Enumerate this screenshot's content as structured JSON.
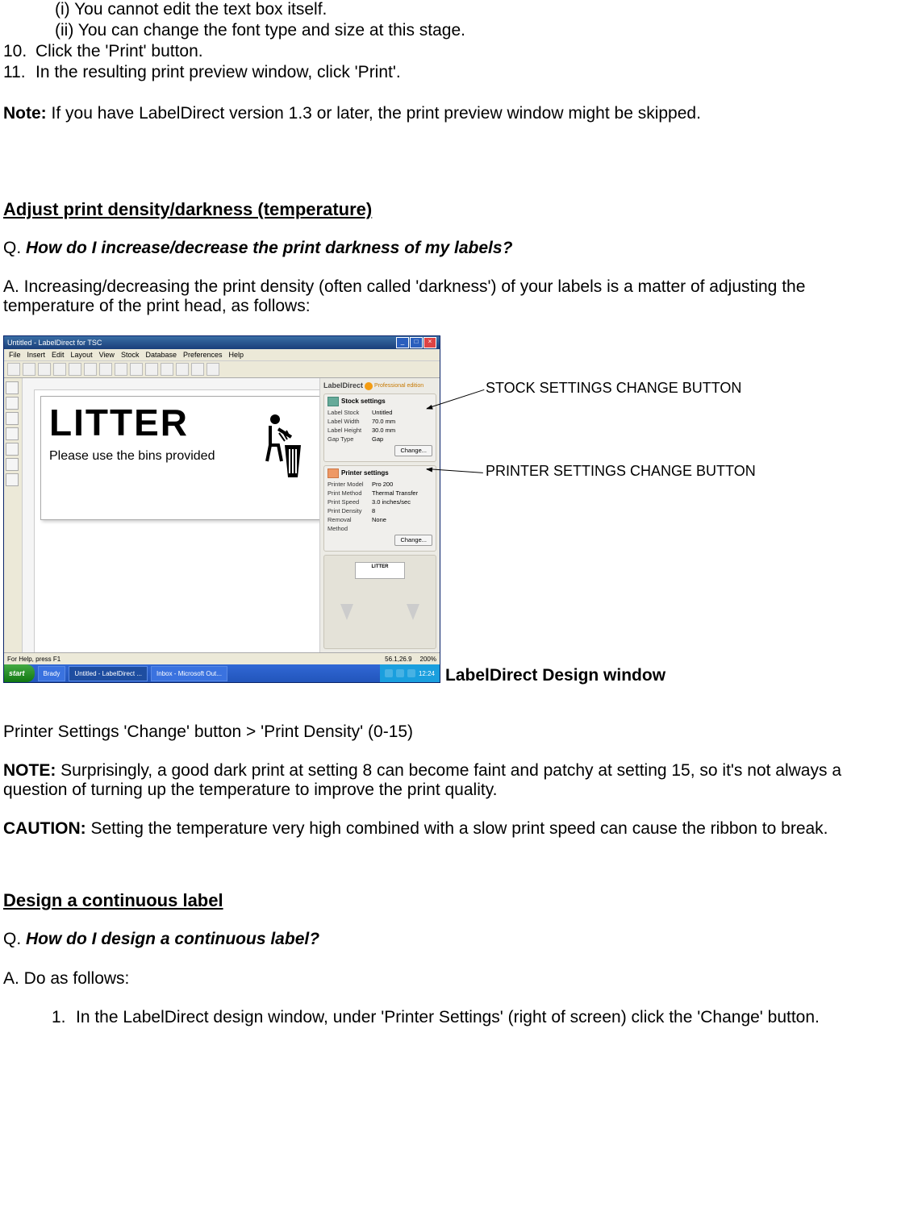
{
  "top_lines": {
    "i": "(i) You cannot edit the text box itself.",
    "ii": "(ii) You can change the font type and size at this  stage.",
    "ten_num": "10.",
    "ten_body": "Click the 'Print' button.",
    "eleven_num": "11.",
    "eleven_body": "In the resulting print preview window, click  'Print'."
  },
  "note_label": "Note:",
  "note_body": "  If you have LabelDirect version 1.3 or later, the print preview window might be skipped.",
  "sec1_heading": "Adjust print density/darkness (temperature)",
  "sec1_q_prefix": "Q.  ",
  "sec1_q": "How do I increase/decrease the print darkness of my labels?",
  "sec1_a": "A.  Increasing/decreasing the print density (often called 'darkness') of your labels is a matter of adjusting the temperature of the print head, as follows:",
  "screenshot": {
    "title": "Untitled - LabelDirect for TSC",
    "menus": [
      "File",
      "Insert",
      "Edit",
      "Layout",
      "View",
      "Stock",
      "Database",
      "Preferences",
      "Help"
    ],
    "label_title": "LITTER",
    "label_sub": "Please use the bins provided",
    "brand": "LabelDirect",
    "edition": "Professional edition",
    "stock_panel": {
      "header": "Stock settings",
      "rows": [
        {
          "k": "Label Stock",
          "v": "Untitled"
        },
        {
          "k": "Label Width",
          "v": "70.0    mm"
        },
        {
          "k": "Label Height",
          "v": "30.0    mm"
        },
        {
          "k": "Gap Type",
          "v": "Gap"
        }
      ],
      "change": "Change..."
    },
    "printer_panel": {
      "header": "Printer settings",
      "rows": [
        {
          "k": "Printer Model",
          "v": "Pro 200"
        },
        {
          "k": "Print Method",
          "v": "Thermal Transfer"
        },
        {
          "k": "Print Speed",
          "v": "3.0    inches/sec"
        },
        {
          "k": "Print Density",
          "v": "8"
        },
        {
          "k": "Removal Method",
          "v": "None"
        }
      ],
      "change": "Change..."
    },
    "preview_label": "LITTER",
    "status_left": "For Help, press F1",
    "status_coords": "56.1,26.9",
    "status_zoom": "200%",
    "start": "start",
    "task1": "Brady",
    "task2": "Untitled - LabelDirect ...",
    "task3": "Inbox - Microsoft Out...",
    "clock": "12:24"
  },
  "caption": "LabelDirect Design window",
  "annotation1": "STOCK SETTINGS CHANGE BUTTON",
  "annotation2": "PRINTER SETTINGS CHANGE BUTTON",
  "sec1_path": "Printer Settings 'Change' button > 'Print Density' (0-15)",
  "sec1_note_label": "NOTE:",
  "sec1_note_body": " Surprisingly, a good dark print at setting 8 can become faint and patchy at setting 15, so it's not always a question of turning up the temperature to improve the print quality.",
  "sec1_caution_label": "CAUTION:",
  "sec1_caution_body": " Setting the temperature very high combined with a slow print speed can cause the ribbon to break.",
  "sec2_heading": "Design a continuous label",
  "sec2_q_prefix": "Q.  ",
  "sec2_q": "How do I design a continuous label?",
  "sec2_a": "A.  Do as follows:",
  "sec2_step1_num": "1.",
  "sec2_step1_body": "In the LabelDirect design window, under 'Printer  Settings' (right of screen) click the 'Change' button."
}
